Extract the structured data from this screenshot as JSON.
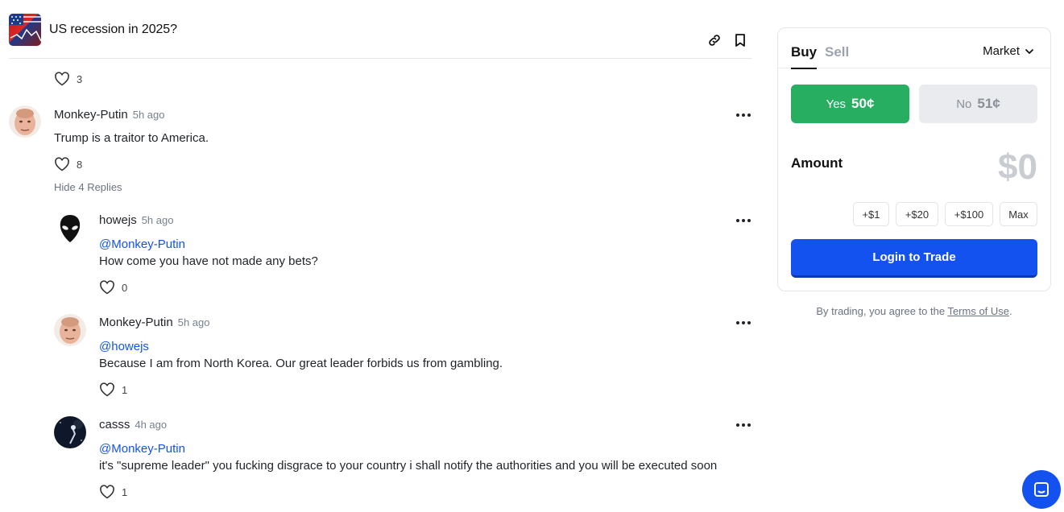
{
  "header": {
    "title": "US recession in 2025?",
    "thumb_icon": "us-flag-chart-thumbnail",
    "link_icon": "link-icon",
    "bookmark_icon": "bookmark-icon"
  },
  "comments": [
    {
      "likes": "3"
    },
    {
      "author": "Monkey-Putin",
      "time": "5h ago",
      "text": "Trump is a traitor to America.",
      "likes": "8",
      "hide_replies": "Hide 4 Replies",
      "replies": [
        {
          "author": "howejs",
          "time": "5h ago",
          "mention": "@Monkey-Putin",
          "text": "How come you have not made any bets?",
          "likes": "0"
        },
        {
          "author": "Monkey-Putin",
          "time": "5h ago",
          "mention": "@howejs",
          "text": "Because I am from North Korea. Our great leader forbids us from gambling.",
          "likes": "1"
        },
        {
          "author": "casss",
          "time": "4h ago",
          "mention": "@Monkey-Putin",
          "text": "it's \"supreme leader\" you fucking disgrace to your country i shall notify the authorities and you will be executed soon",
          "likes": "1"
        }
      ]
    }
  ],
  "trade": {
    "tab_buy": "Buy",
    "tab_sell": "Sell",
    "order_type": "Market",
    "yes_label": "Yes",
    "yes_price": "50¢",
    "no_label": "No",
    "no_price": "51¢",
    "amount_label": "Amount",
    "amount_value": "$0",
    "chips": [
      "+$1",
      "+$20",
      "+$100",
      "Max"
    ],
    "login_button": "Login to Trade",
    "terms_prefix": "By trading, you agree to the ",
    "terms_link": "Terms of Use",
    "terms_suffix": "."
  },
  "colors": {
    "accent_blue": "#1452f0",
    "yes_green": "#27ae60",
    "no_gray": "#e9ebee"
  },
  "chat_icon": "chat-support-icon"
}
